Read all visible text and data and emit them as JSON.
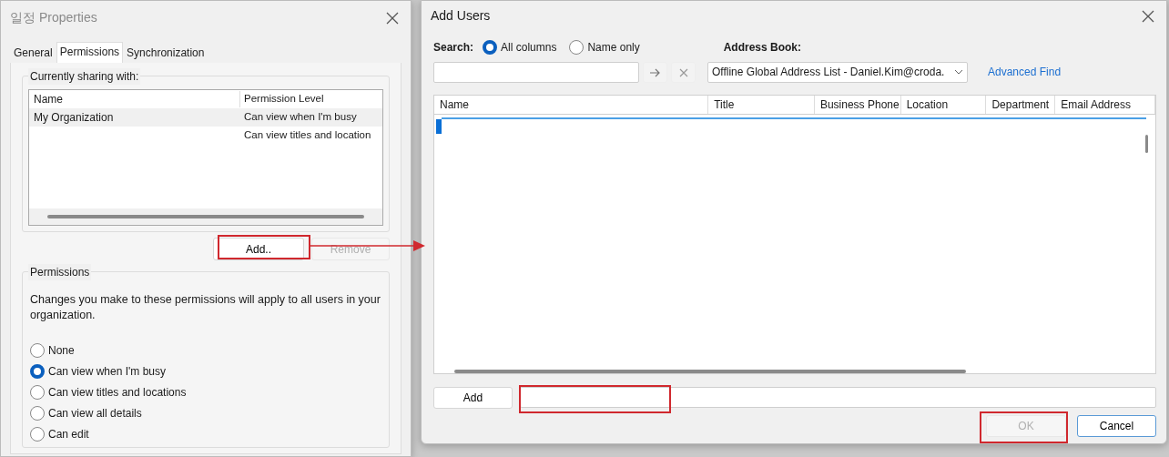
{
  "properties_dialog": {
    "title": "일정 Properties",
    "tabs": [
      {
        "label": "General",
        "selected": false
      },
      {
        "label": "Permissions",
        "selected": true
      },
      {
        "label": "Synchronization",
        "selected": false
      }
    ],
    "sharing": {
      "legend": "Currently sharing with:",
      "columns": [
        "Name",
        "Permission Level"
      ],
      "rows": [
        {
          "name": "My Organization",
          "permission": "Can view when I'm busy",
          "selected": true
        },
        {
          "permission": "Can view titles and location",
          "selected": false
        }
      ]
    },
    "add_button": "Add..",
    "remove_button": {
      "label": "Remove",
      "disabled": true
    },
    "permissions": {
      "legend": "Permissions",
      "note": "Changes you make to these permissions will apply to all users in your organization.",
      "options": [
        {
          "label": "None",
          "selected": false
        },
        {
          "label": "Can view when I'm busy",
          "selected": true
        },
        {
          "label": "Can view titles and locations",
          "selected": false
        },
        {
          "label": "Can view all details",
          "selected": false
        },
        {
          "label": "Can edit",
          "selected": false
        }
      ]
    }
  },
  "add_users_dialog": {
    "title": "Add Users",
    "search_label": "Search:",
    "search_modes": [
      {
        "label": "All columns",
        "selected": true
      },
      {
        "label": "Name only",
        "selected": false
      }
    ],
    "address_book_label": "Address Book:",
    "address_book": "Offline Global Address List - Daniel.Kim@croda.",
    "advanced_find": "Advanced Find",
    "columns": [
      "Name",
      "Title",
      "Business Phone",
      "Location",
      "Department",
      "Email Address"
    ],
    "add_button": "Add",
    "ok_button": {
      "label": "OK",
      "disabled": true
    },
    "cancel_button": "Cancel"
  }
}
